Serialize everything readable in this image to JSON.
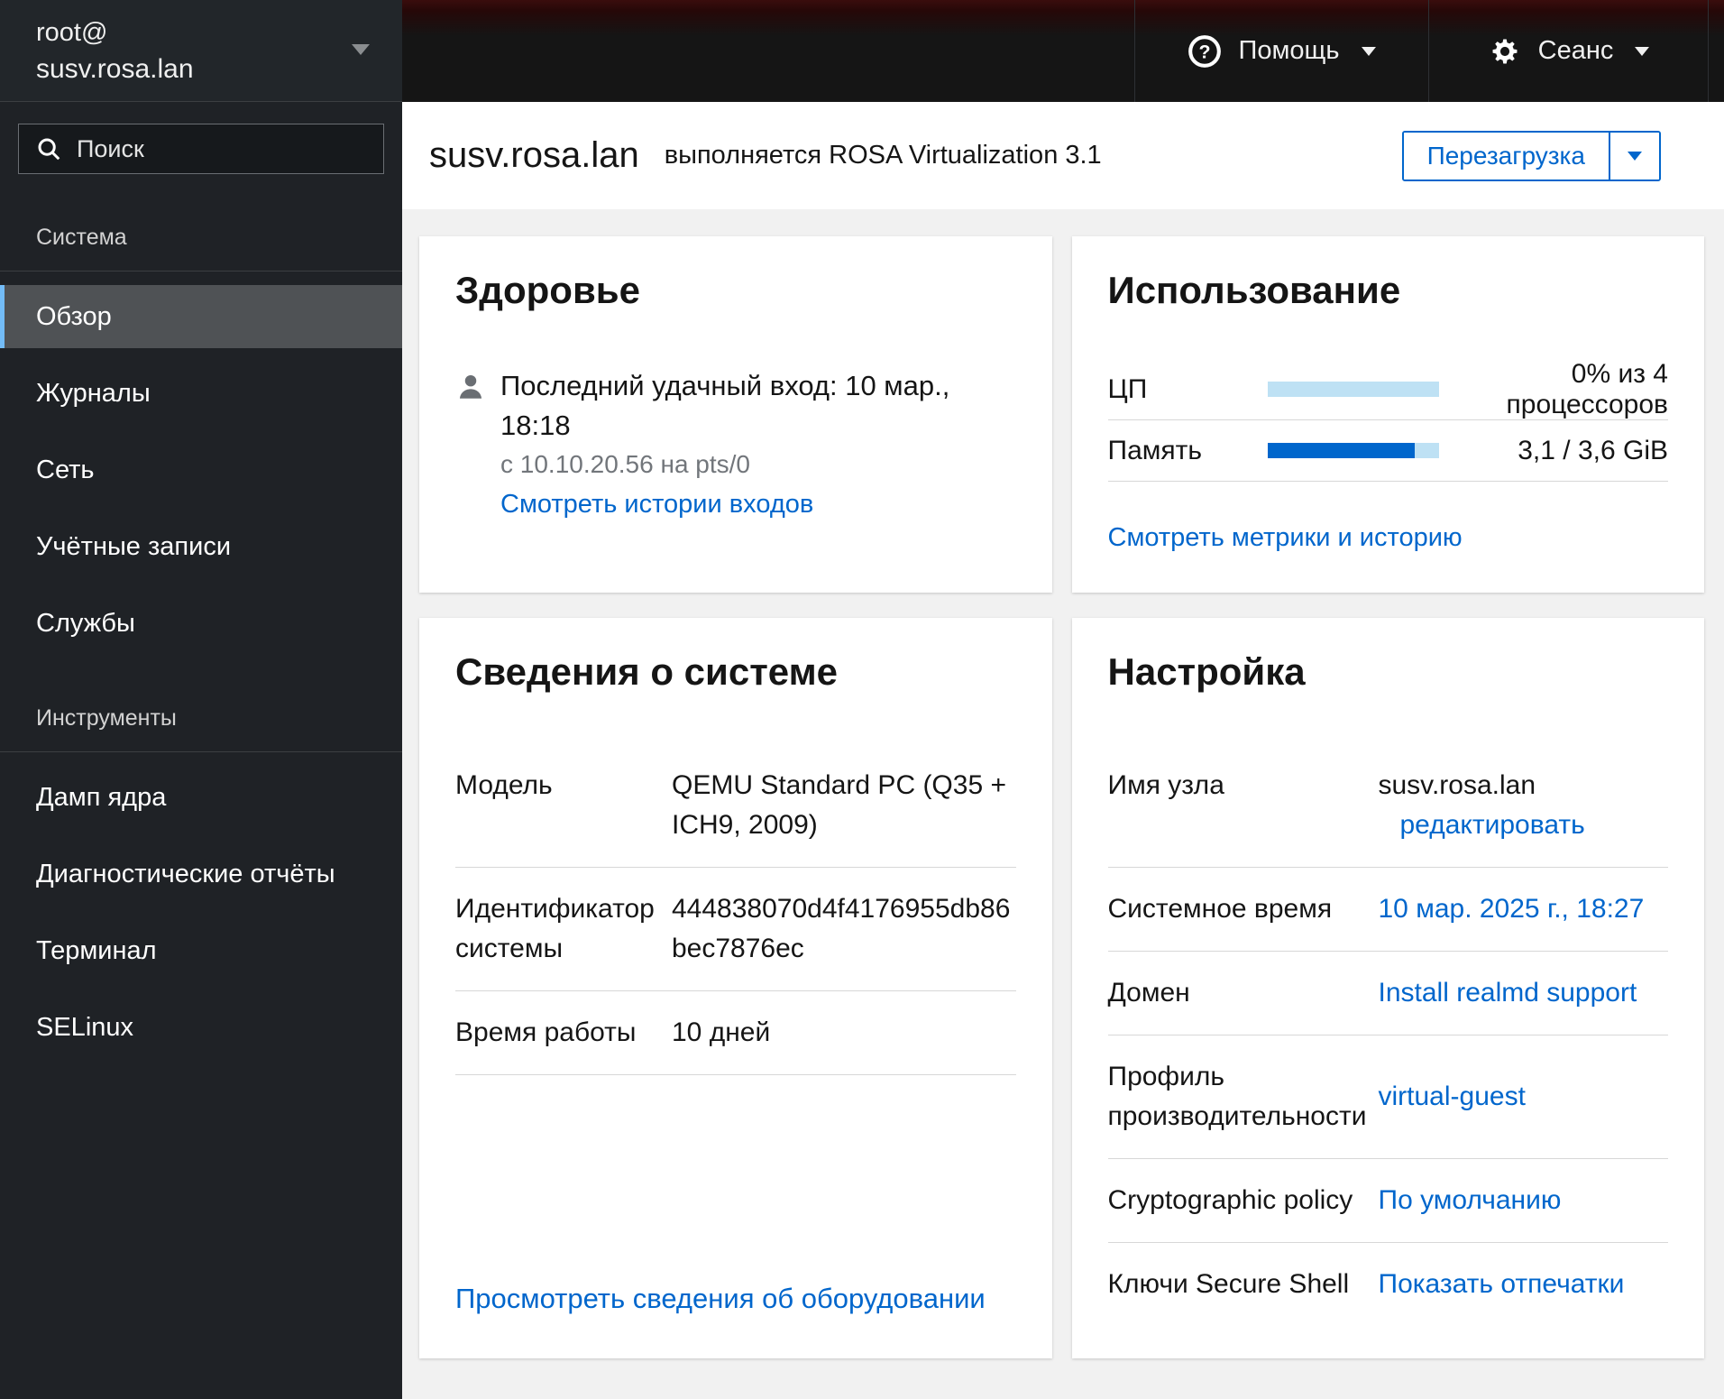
{
  "masthead": {
    "host_user": "root@",
    "host_name": "susv.rosa.lan",
    "help_label": "Помощь",
    "session_label": "Сеанс"
  },
  "sidebar": {
    "search_placeholder": "Поиск",
    "sections": [
      {
        "label": "Система",
        "items": [
          {
            "label": "Обзор"
          },
          {
            "label": "Журналы"
          },
          {
            "label": "Сеть"
          },
          {
            "label": "Учётные записи"
          },
          {
            "label": "Службы"
          }
        ]
      },
      {
        "label": "Инструменты",
        "items": [
          {
            "label": "Дамп ядра"
          },
          {
            "label": "Диагностические отчёты"
          },
          {
            "label": "Терминал"
          },
          {
            "label": "SELinux"
          }
        ]
      }
    ]
  },
  "header": {
    "hostname": "susv.rosa.lan",
    "subtitle": "выполняется ROSA Virtualization 3.1",
    "reboot_label": "Перезагрузка"
  },
  "cards": {
    "health": {
      "title": "Здоровье",
      "last_login": "Последний удачный вход: 10 мар., 18:18",
      "login_from": "с 10.10.20.56 на pts/0",
      "login_history_link": "Смотреть истории входов"
    },
    "usage": {
      "title": "Использование",
      "cpu_label": "ЦП",
      "cpu_value": "0% из 4 процессоров",
      "cpu_percent": 0,
      "memory_label": "Память",
      "memory_value": "3,1 / 3,6 GiB",
      "memory_percent": 86,
      "metrics_link": "Смотреть метрики и историю"
    },
    "system": {
      "title": "Сведения о системе",
      "rows": [
        {
          "label": "Модель",
          "value": "QEMU Standard PC (Q35 + ICH9, 2009)"
        },
        {
          "label": "Идентификатор системы",
          "value": "444838070d4f4176955db86bec7876ec"
        },
        {
          "label": "Время работы",
          "value": "10 дней"
        }
      ],
      "hardware_link": "Просмотреть сведения об оборудовании"
    },
    "config": {
      "title": "Настройка",
      "rows": [
        {
          "label": "Имя узла",
          "value": "susv.rosa.lan",
          "link": "редактировать"
        },
        {
          "label": "Системное время",
          "link": "10 мар. 2025 г., 18:27"
        },
        {
          "label": "Домен",
          "link": "Install realmd support"
        },
        {
          "label": "Профиль производительности",
          "link": "virtual-guest"
        },
        {
          "label": "Cryptographic policy",
          "link": "По умолчанию"
        },
        {
          "label": "Ключи Secure Shell",
          "link": "Показать отпечатки"
        }
      ]
    }
  },
  "colors": {
    "accent_blue": "#0066cc",
    "selected_indicator": "#73bcf7",
    "progress_track": "#bee1f4",
    "masthead_red": "#3a0d0d",
    "sidebar_bg": "#1f2226"
  }
}
